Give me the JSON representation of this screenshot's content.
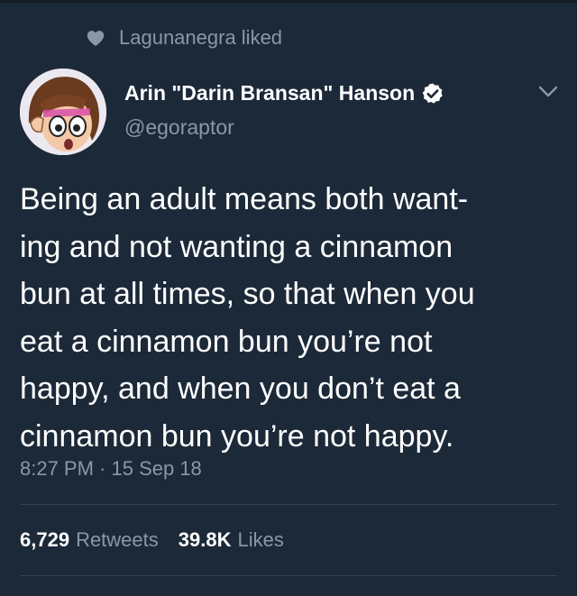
{
  "social_context": {
    "text": "Lagunanegra liked",
    "icon": "heart-icon"
  },
  "author": {
    "display_name": "Arin \"Darin Bransan\" Hanson",
    "handle": "@egoraptor",
    "verified": true,
    "avatar": "cartoon-avatar"
  },
  "tweet": {
    "lines": [
      "Being an adult means both want-",
      "ing and not wanting a cinnamon",
      "bun at all times, so that when you",
      "eat a cinnamon bun you’re not",
      "happy, and when you don’t eat a",
      "cinnamon bun you’re not happy."
    ],
    "timestamp": "8:27 PM · 15 Sep 18"
  },
  "stats": {
    "retweets_count": "6,729",
    "retweets_label": "Retweets",
    "likes_count": "39.8K",
    "likes_label": "Likes"
  },
  "colors": {
    "background": "#1c2938",
    "primary_text": "#ffffff",
    "secondary_text": "#8899a6",
    "divider": "#38444d"
  }
}
